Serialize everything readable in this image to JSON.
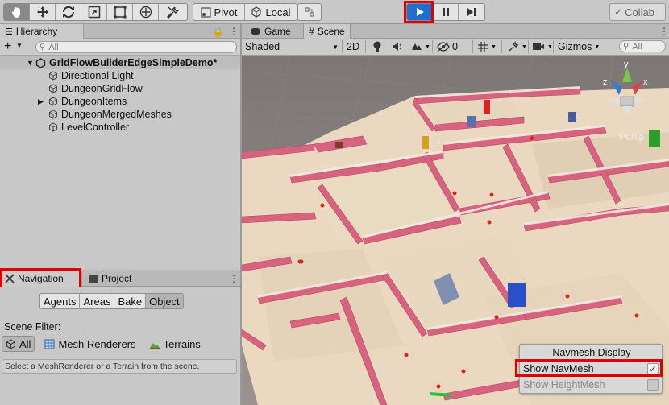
{
  "toolbar": {
    "pivot_label": "Pivot",
    "local_label": "Local",
    "collab_label": "Collab"
  },
  "hierarchy": {
    "tab_label": "Hierarchy",
    "search_placeholder": "All",
    "root": "GridFlowBuilderEdgeSimpleDemo*",
    "items": [
      {
        "label": "Directional Light",
        "expandable": false
      },
      {
        "label": "DungeonGridFlow",
        "expandable": false
      },
      {
        "label": "DungeonItems",
        "expandable": true
      },
      {
        "label": "DungeonMergedMeshes",
        "expandable": false
      },
      {
        "label": "LevelController",
        "expandable": false
      }
    ]
  },
  "navigation": {
    "tab_label": "Navigation",
    "project_tab_label": "Project",
    "modes": [
      "Agents",
      "Areas",
      "Bake",
      "Object"
    ],
    "active_mode": "Object",
    "scene_filter_label": "Scene Filter:",
    "filters": [
      "All",
      "Mesh Renderers",
      "Terrains"
    ],
    "active_filter": "All",
    "help_text": "Select a MeshRenderer or a Terrain from the scene."
  },
  "scene": {
    "game_tab_label": "Game",
    "scene_tab_label": "Scene",
    "shading_mode": "Shaded",
    "dim_mode": "2D",
    "hidden_count": "0",
    "gizmos_label": "Gizmos",
    "search_placeholder": "All",
    "persp_label": "Persp",
    "gizmo_axes": {
      "x": "x",
      "y": "y",
      "z": "z"
    }
  },
  "navmesh_display": {
    "title": "Navmesh Display",
    "show_navmesh_label": "Show NavMesh",
    "show_navmesh_checked": true,
    "show_heightmesh_label": "Show HeightMesh",
    "show_heightmesh_checked": false
  },
  "colors": {
    "highlight": "#e00000",
    "play_blue": "#1e6fd0",
    "floor": "#ece0c8",
    "wall": "#d86a86"
  }
}
